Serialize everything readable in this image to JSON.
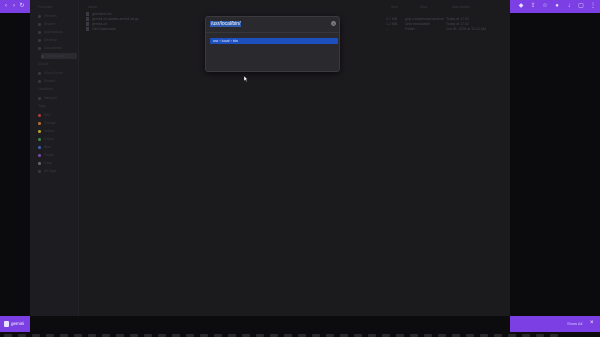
{
  "dialog": {
    "input_value": "/usr/local/bin/",
    "suggestion": "usr › local › bin"
  },
  "finder": {
    "sidebar": [
      {
        "label": "Favorites",
        "kind": "header"
      },
      {
        "label": "Recents"
      },
      {
        "label": "Shared"
      },
      {
        "label": "Applications"
      },
      {
        "label": "Desktop"
      },
      {
        "label": "Documents"
      },
      {
        "label": "Downloads",
        "selected": true
      },
      {
        "label": "iCloud",
        "kind": "header"
      },
      {
        "label": "iCloud Drive"
      },
      {
        "label": "Shared"
      },
      {
        "label": "Locations",
        "kind": "header"
      },
      {
        "label": "Network"
      },
      {
        "label": "Tags",
        "kind": "header"
      },
      {
        "label": "Red",
        "color": "#b33a3a"
      },
      {
        "label": "Orange",
        "color": "#b8702e"
      },
      {
        "label": "Yellow",
        "color": "#b8a22e"
      },
      {
        "label": "Green",
        "color": "#3e8a48"
      },
      {
        "label": "Blue",
        "color": "#3a62b0"
      },
      {
        "label": "Purple",
        "color": "#7a49a8"
      },
      {
        "label": "Gray",
        "color": "#6a6a6e"
      },
      {
        "label": "All Tags..."
      }
    ],
    "columns": [
      "Name",
      "Size",
      "Kind",
      "Date Added"
    ],
    "rows": [
      {
        "name": "geminicli.md",
        "size": "",
        "kind": "",
        "date": ""
      },
      {
        "name": "gemini-cli-darwin-arm64.tar.gz",
        "size": "4.7 MB",
        "kind": "gzip compressed archive",
        "date": "Today at 17:02"
      },
      {
        "name": "gemini-cli",
        "size": "1.2 MB",
        "kind": "Unix executable",
        "date": "Today at 17:02"
      },
      {
        "name": "Old Downloads",
        "size": "--",
        "kind": "Folder",
        "date": "Jun 26, 2025 at 10:12 AM"
      }
    ],
    "status_path": [
      "Macintosh HD",
      "Users",
      "Downloads",
      "gemini"
    ]
  },
  "bottom": {
    "doc_label": "gemini",
    "right_label": "Show All"
  },
  "colors": {
    "accent": "#7b3fe4",
    "selection": "#1d4fbf"
  }
}
